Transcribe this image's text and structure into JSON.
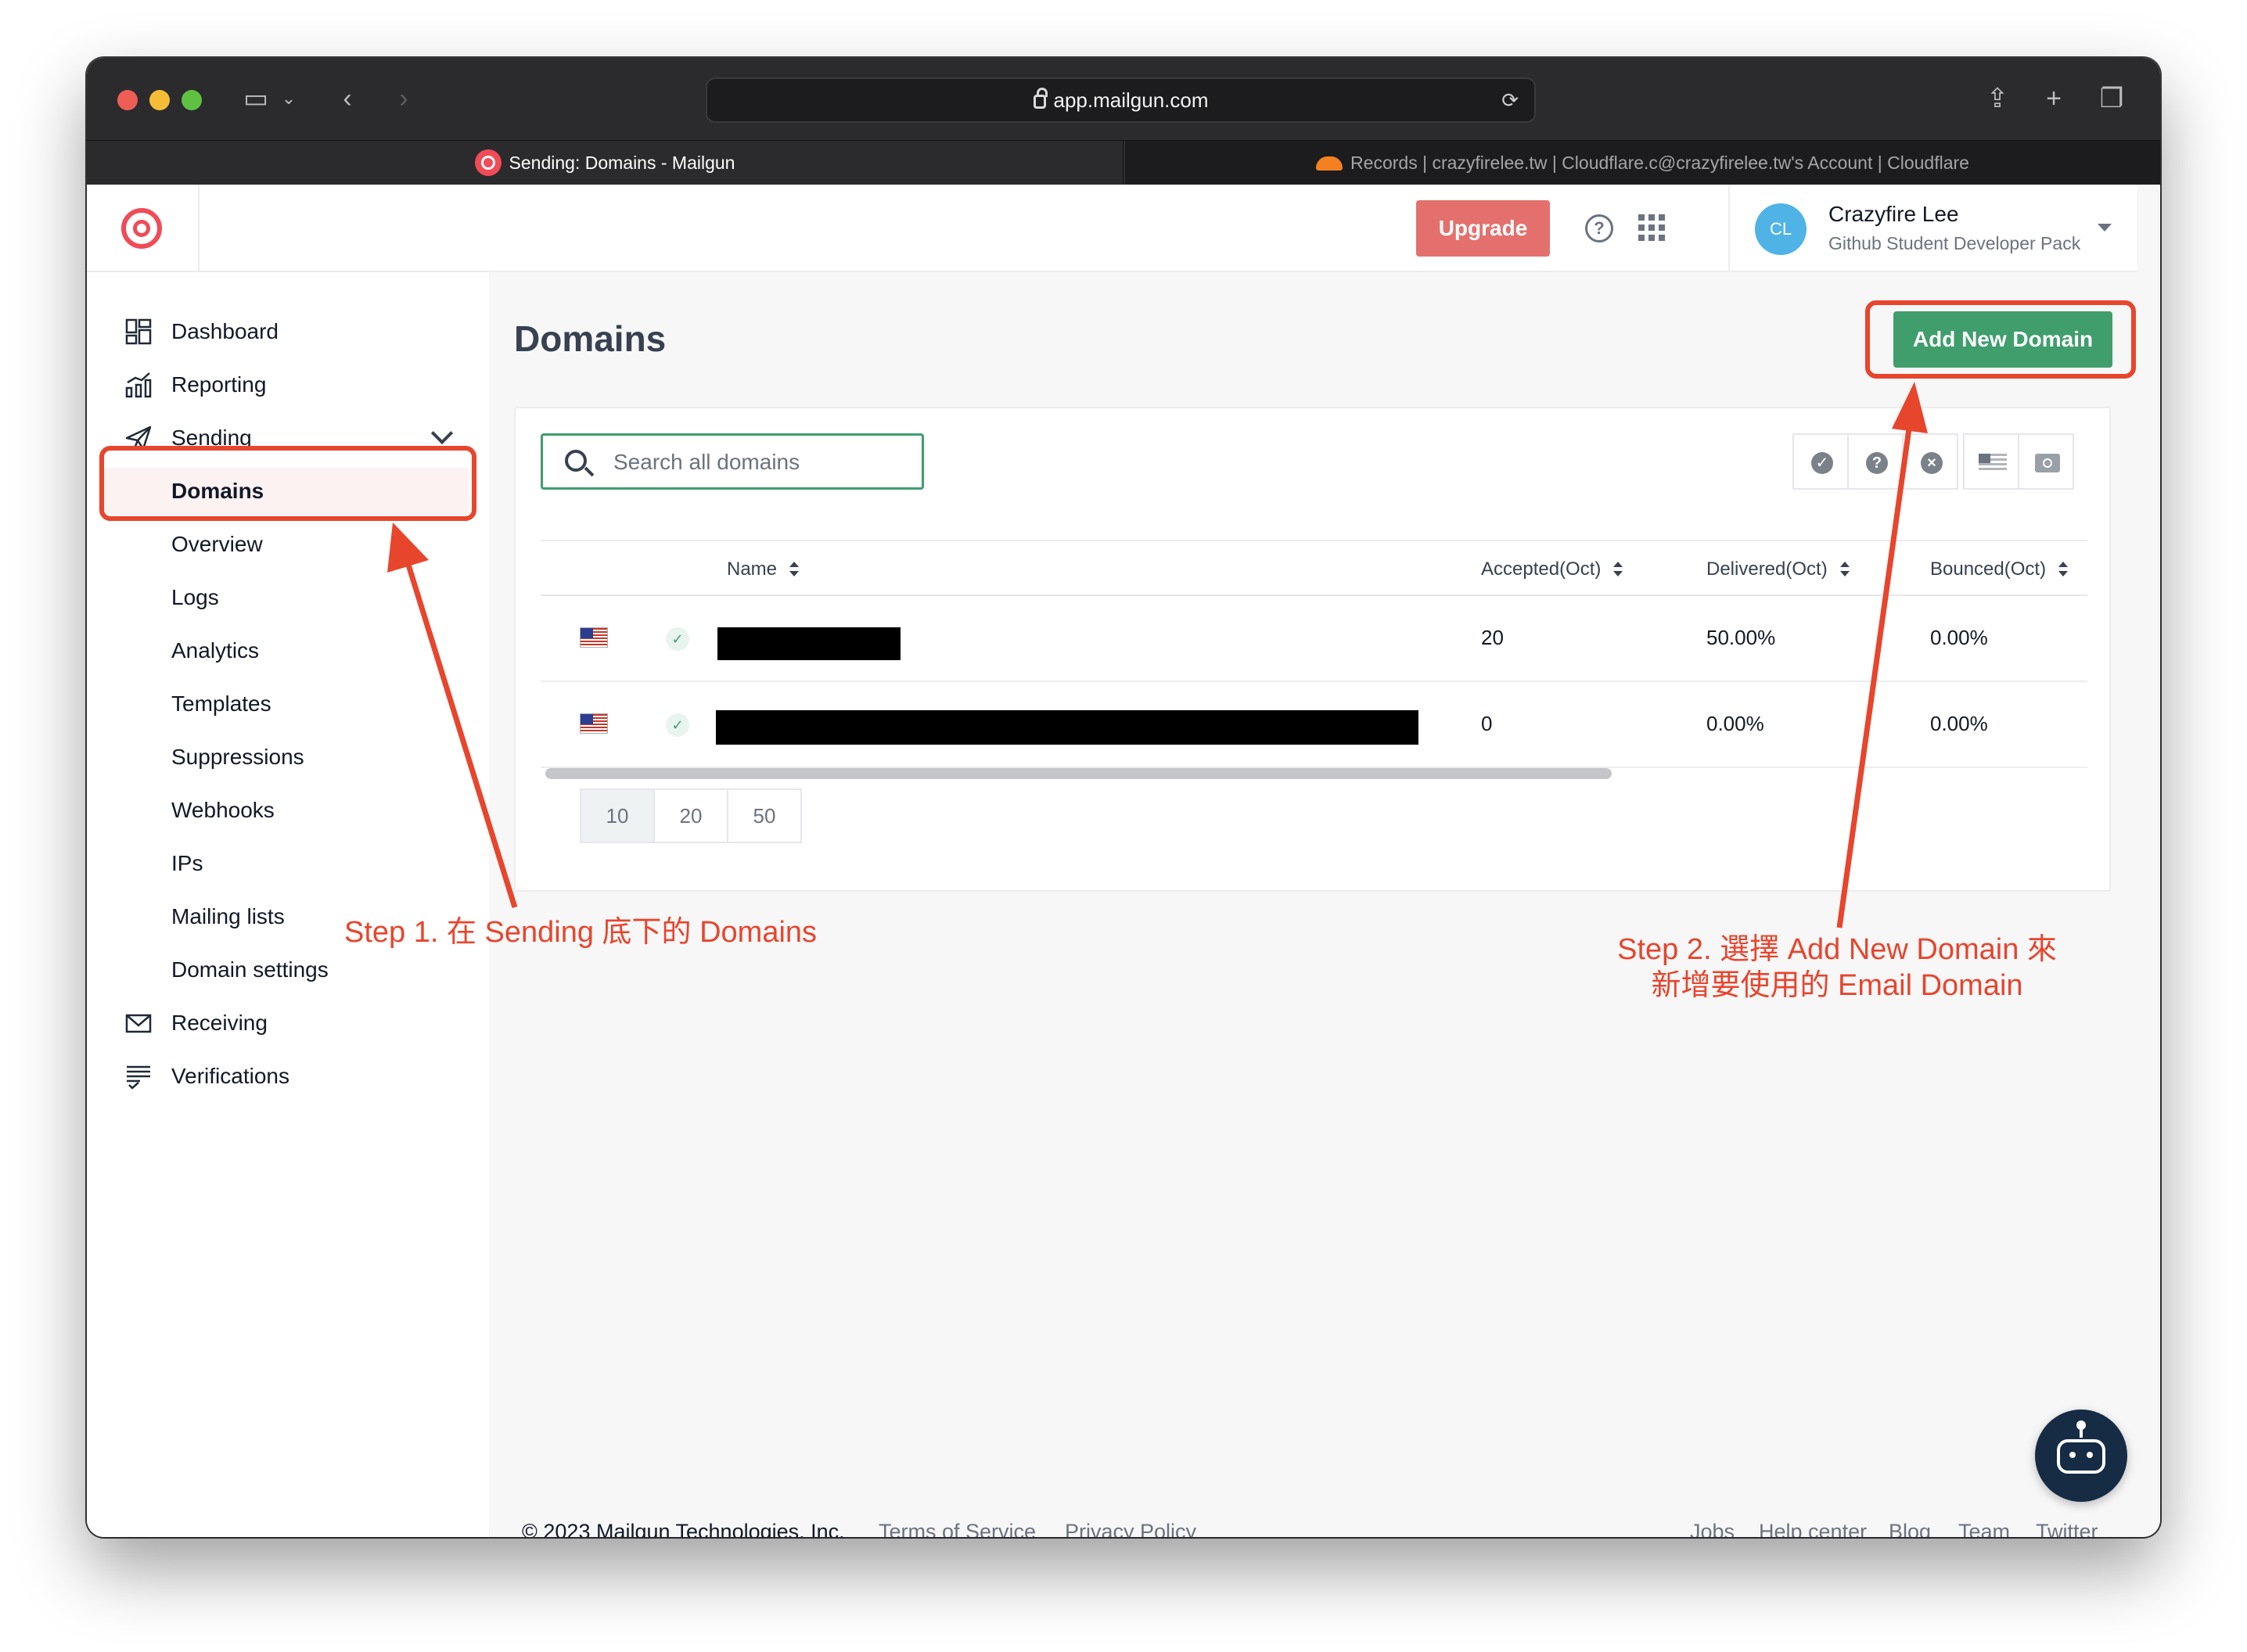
{
  "browser": {
    "url": "app.mailgun.com",
    "tabs": [
      {
        "label": "Sending: Domains - Mailgun"
      },
      {
        "label": "Records | crazyfirelee.tw | Cloudflare.c@crazyfirelee.tw's Account | Cloudflare"
      }
    ]
  },
  "header": {
    "upgrade_label": "Upgrade",
    "user": {
      "initials": "CL",
      "name": "Crazyfire Lee",
      "plan": "Github Student Developer Pack"
    }
  },
  "sidebar": {
    "items": [
      {
        "label": "Dashboard"
      },
      {
        "label": "Reporting"
      },
      {
        "label": "Sending"
      },
      {
        "label": "Domains"
      },
      {
        "label": "Overview"
      },
      {
        "label": "Logs"
      },
      {
        "label": "Analytics"
      },
      {
        "label": "Templates"
      },
      {
        "label": "Suppressions"
      },
      {
        "label": "Webhooks"
      },
      {
        "label": "IPs"
      },
      {
        "label": "Mailing lists"
      },
      {
        "label": "Domain settings"
      },
      {
        "label": "Receiving"
      },
      {
        "label": "Verifications"
      }
    ]
  },
  "main": {
    "title": "Domains",
    "add_button_label": "Add New Domain",
    "search": {
      "placeholder": "Search all domains"
    },
    "table": {
      "columns": [
        "Name",
        "Accepted(Oct)",
        "Delivered(Oct)",
        "Bounced(Oct)"
      ],
      "rows": [
        {
          "name": "",
          "accepted": "20",
          "delivered": "50.00%",
          "bounced": "0.00%"
        },
        {
          "name": "",
          "accepted": "0",
          "delivered": "0.00%",
          "bounced": "0.00%"
        }
      ]
    },
    "page_sizes": [
      "10",
      "20",
      "50"
    ]
  },
  "footer": {
    "copyright": "© 2023 Mailgun Technologies, Inc.",
    "left_links": [
      "Terms of Service",
      "Privacy Policy"
    ],
    "right_links": [
      "Jobs",
      "Help center",
      "Blog",
      "Team",
      "Twitter"
    ]
  },
  "annotations": {
    "step1": "Step 1. 在 Sending 底下的 Domains",
    "step2_line1": "Step 2. 選擇 Add New Domain 來",
    "step2_line2": "新增要使用的 Email Domain",
    "color": "#e8452d"
  }
}
